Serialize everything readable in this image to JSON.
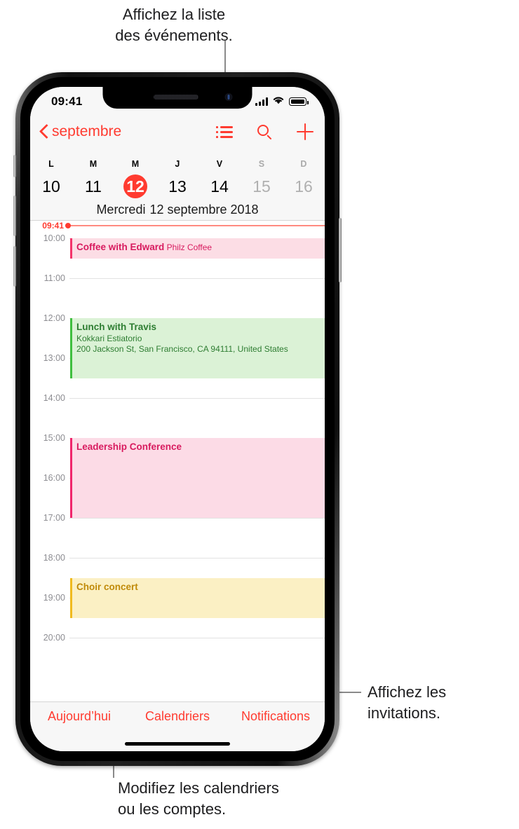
{
  "callouts": {
    "top": "Affichez la liste\ndes événements.",
    "right": "Affichez les\ninvitations.",
    "bottom": "Modifiez les calendriers\nou les comptes."
  },
  "status_bar": {
    "time": "09:41",
    "cellular_icon": "signal-bars-icon",
    "wifi_icon": "wifi-icon",
    "battery_icon": "battery-icon"
  },
  "nav_bar": {
    "back_label": "septembre",
    "back_icon": "chevron-left-icon",
    "actions": [
      {
        "name": "list-view-icon"
      },
      {
        "name": "search-icon"
      },
      {
        "name": "add-event-icon"
      }
    ]
  },
  "week_strip": {
    "weekday_initials": [
      "L",
      "M",
      "M",
      "J",
      "V",
      "S",
      "D"
    ],
    "weekday_dim": [
      false,
      false,
      false,
      false,
      false,
      true,
      true
    ],
    "days": [
      "10",
      "11",
      "12",
      "13",
      "14",
      "15",
      "16"
    ],
    "today_index": 2,
    "dim_days": [
      5,
      6
    ],
    "date_weekday": "Mercredi",
    "date_rest": "12 septembre 2018"
  },
  "timeline": {
    "hours": [
      "10:00",
      "11:00",
      "12:00",
      "13:00",
      "14:00",
      "15:00",
      "16:00",
      "17:00",
      "18:00",
      "19:00",
      "20:00"
    ],
    "now_label": "09:41",
    "now_color": "#ff3b30",
    "events": [
      {
        "title": "Coffee with Edward",
        "subtitle": "Philz Coffee",
        "lines": [],
        "start": "10:00",
        "end": "10:30",
        "bg": "#fcdde5",
        "accent": "#f4336a",
        "text": "#d81b5f"
      },
      {
        "title": "Lunch with Travis",
        "subtitle": "",
        "lines": [
          "Kokkari Estiatorio",
          "200 Jackson St, San Francisco, CA  94111, United States"
        ],
        "start": "12:00",
        "end": "13:30",
        "bg": "#dbf2d6",
        "accent": "#3fbf3f",
        "text": "#2e7d32"
      },
      {
        "title": "Leadership Conference",
        "subtitle": "",
        "lines": [],
        "start": "15:00",
        "end": "17:00",
        "bg": "#fcdbe6",
        "accent": "#f0256b",
        "text": "#d81b5f"
      },
      {
        "title": "Choir concert",
        "subtitle": "",
        "lines": [],
        "start": "18:30",
        "end": "19:30",
        "bg": "#fbf0c4",
        "accent": "#f0ba1e",
        "text": "#c08a09"
      }
    ]
  },
  "tab_bar": {
    "items": [
      "Aujourd’hui",
      "Calendriers",
      "Notifications"
    ]
  },
  "colors": {
    "accent": "#ff3b30",
    "screen_bg": "#ffffff",
    "chrome_bg": "#f7f7f7",
    "grid_line": "#e2e2e2"
  }
}
